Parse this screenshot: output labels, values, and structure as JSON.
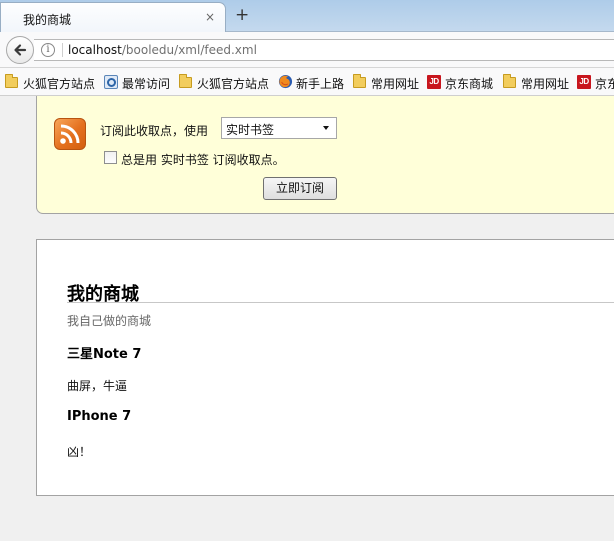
{
  "tab": {
    "title": "我的商城",
    "close_glyph": "×",
    "new_tab_glyph": "+"
  },
  "navbar": {
    "url_host": "localhost",
    "url_path": "/booledu/xml/feed.xml"
  },
  "bookmarks": [
    {
      "label": "火狐官方站点",
      "icon": "folder-icon"
    },
    {
      "label": "最常访问",
      "icon": "most-visited-icon"
    },
    {
      "label": "火狐官方站点",
      "icon": "folder-icon"
    },
    {
      "label": "新手上路",
      "icon": "firefox-icon"
    },
    {
      "label": "常用网址",
      "icon": "folder-icon"
    },
    {
      "label": "京东商城",
      "icon": "jd-icon"
    },
    {
      "label": "常用网址",
      "icon": "folder-icon"
    },
    {
      "label": "京东商城",
      "icon": "jd-icon"
    }
  ],
  "jd_badge": "JD",
  "subscribe": {
    "label": "订阅此收取点，使用",
    "reader_value": "实时书签",
    "always_use_label": "总是用 实时书签 订阅收取点。",
    "always_use_checked": false,
    "button_label": "立即订阅"
  },
  "feed": {
    "title": "我的商城",
    "subtitle": "我自己做的商城",
    "entries": [
      {
        "title": "三星Note 7",
        "description": "曲屏，牛逼"
      },
      {
        "title": "IPhone 7",
        "description": "凶！"
      }
    ]
  },
  "colors": {
    "notice_background": "#ffffd9",
    "rss_orange": "#e4701e",
    "jd_red": "#c8161e"
  }
}
